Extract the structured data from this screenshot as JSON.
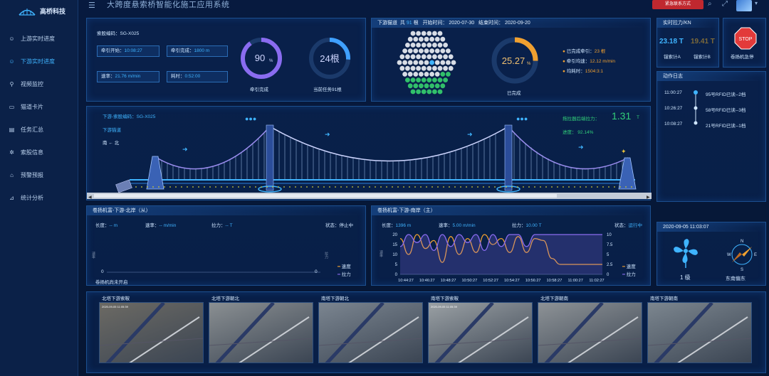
{
  "app": {
    "logo_text": "高桥科技",
    "title": "大跨度悬索桥智能化施工应用系统",
    "emergency_button": "紧急联系方式"
  },
  "sidebar": {
    "items": [
      {
        "label": "上游实时进度",
        "icon": "user-icon",
        "active": false
      },
      {
        "label": "下游实时进度",
        "icon": "user-icon",
        "active": true
      },
      {
        "label": "视频监控",
        "icon": "location-icon",
        "active": false
      },
      {
        "label": "猫道卡片",
        "icon": "card-icon",
        "active": false
      },
      {
        "label": "任务汇总",
        "icon": "list-icon",
        "active": false
      },
      {
        "label": "索股信息",
        "icon": "gear-icon",
        "active": false
      },
      {
        "label": "预警预报",
        "icon": "building-icon",
        "active": false
      },
      {
        "label": "统计分析",
        "icon": "chart-icon",
        "active": false
      }
    ]
  },
  "strand_panel": {
    "code_label": "索股编码：SG-X025",
    "start_label": "牵引开始：",
    "start_value": "10:08:27",
    "end_label": "牵引完成：",
    "end_value": "1800 m",
    "speed_label": "速率：",
    "speed_value": "21.76 m/min",
    "time_label": "耗时：",
    "time_value": "0:52:00",
    "gauge1_value": "90",
    "gauge1_unit": "%",
    "gauge1_pct": 0.9,
    "gauge1_label": "牵引完成",
    "gauge2_value": "24根",
    "gauge2_pct": 0.26,
    "gauge2_label": "当前任务91根"
  },
  "catwalk_panel": {
    "title_a": "下游猫道",
    "title_b": "共",
    "count": "91",
    "title_c": "根",
    "start": "开始时间：  2020-07-30",
    "end": "结束时间：  2020-09-20",
    "hex_done": 23,
    "hex_total": 91,
    "gauge_value": "25.27",
    "gauge_unit": "%",
    "gauge_pct": 0.2527,
    "gauge_label": "已完成",
    "stats": [
      {
        "label": "已完成牵引：",
        "value": "23 根"
      },
      {
        "label": "牵引均速：",
        "value": "12.12 m/min"
      },
      {
        "label": "均耗时：",
        "value": "1504:3:1"
      }
    ]
  },
  "tension": {
    "title": "实时拉力/KN",
    "a_value": "23.18 T",
    "b_value": "19.41 T",
    "a_label": "锚索计A",
    "b_label": "锚索计B",
    "stop_text": "STOP",
    "stop_label": "卷扬机急停"
  },
  "log": {
    "title": "动作日志",
    "items": [
      {
        "time": "11:00:27",
        "text": "95号RFID已读--2档"
      },
      {
        "time": "10:26:27",
        "text": "58号RFID已读--3档"
      },
      {
        "time": "10:08:27",
        "text": "21号RFID已读--1档"
      }
    ]
  },
  "bridge": {
    "line1": "下游-索股编码：SG-X025",
    "line2": "下游猫道",
    "line3": "南 ← 北",
    "force_label": "拖拉器后端拉力：",
    "force_value": "1.31",
    "force_unit": "T",
    "progress": "进度：  92.14%"
  },
  "winch_left": {
    "title": "卷扬机富-下游-北岸（从）",
    "length_label": "长度：",
    "length_value": "-- m",
    "speed_label": "速率：",
    "speed_value": "-- m/min",
    "force_label": "拉力：",
    "force_value": "-- T",
    "status_label": "状态：",
    "status_value": "停止中",
    "y_left": "速率",
    "y_right": "拉力",
    "zero_left": "0",
    "zero_right": "0",
    "legend_speed": "速度",
    "legend_force": "拉力",
    "note": "卷扬机尚未开启"
  },
  "winch_right": {
    "title": "卷扬机富-下游-南岸（主）",
    "length_label": "长度：",
    "length_value": "1396 m",
    "speed_label": "速率：",
    "speed_value": "5.00 m/min",
    "force_label": "拉力：",
    "force_value": "10.00 T",
    "status_label": "状态：",
    "status_value": "运行中",
    "y_left": "速率",
    "y_right": "拉力",
    "legend_speed": "速度",
    "legend_force": "拉力"
  },
  "chart_data": {
    "type": "line",
    "title": "卷扬机富-下游-南岸（主）",
    "categories": [
      "10:44:27",
      "10:46:27",
      "10:48:27",
      "10:50:27",
      "10:52:27",
      "10:54:27",
      "10:56:27",
      "10:58:27",
      "11:00:27",
      "11:02:27"
    ],
    "ylim_left": [
      0,
      20
    ],
    "yticks_left": [
      0,
      5,
      10,
      15,
      20
    ],
    "ylim_right": [
      0,
      10
    ],
    "yticks_right": [
      0,
      2.5,
      5,
      7.5,
      10
    ],
    "series": [
      {
        "name": "速度",
        "color": "#f0a030",
        "axis": "left",
        "values": [
          18,
          10,
          20,
          13,
          17,
          6,
          19,
          10,
          18,
          11,
          20,
          15,
          18,
          11,
          19,
          11,
          18,
          17,
          8,
          5,
          5,
          5,
          5,
          5,
          5
        ]
      },
      {
        "name": "拉力",
        "color": "#8a6cf0",
        "axis": "right",
        "values": [
          7,
          10,
          8,
          10,
          6,
          10,
          7,
          10,
          8,
          10,
          6,
          10,
          7,
          10,
          10,
          7,
          10,
          10,
          10,
          10,
          10,
          10,
          10,
          10,
          10
        ]
      }
    ]
  },
  "weather": {
    "datetime": "2020-09-05 11:03:07",
    "wind_level": "1 级",
    "wind_dir": "东南偏东",
    "compass": {
      "n": "N",
      "s": "S",
      "w": "W",
      "e": "E"
    }
  },
  "cameras": [
    {
      "label": "北塔下游索鞍",
      "stamp": "2020-09-05  11:05:39"
    },
    {
      "label": "北塔下游朝北",
      "stamp": ""
    },
    {
      "label": "南塔下游朝北",
      "stamp": ""
    },
    {
      "label": "南塔下游索鞍",
      "stamp": "2020-09-05  11:05:39"
    },
    {
      "label": "北塔下游朝南",
      "stamp": ""
    },
    {
      "label": "南塔下游朝南",
      "stamp": ""
    }
  ]
}
